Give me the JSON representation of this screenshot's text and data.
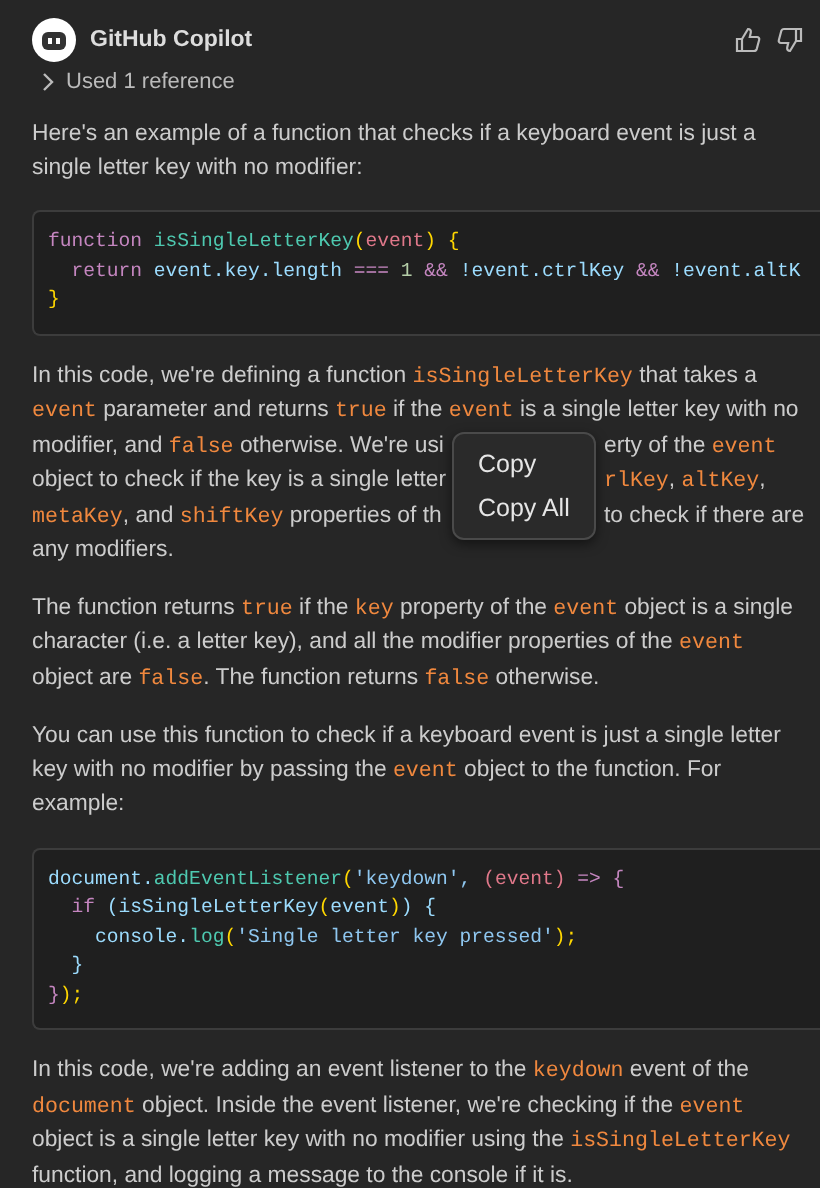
{
  "header": {
    "author": "GitHub Copilot"
  },
  "reference": {
    "label": "Used 1 reference",
    "expanded": false
  },
  "blocks": [
    {
      "kind": "paragraph",
      "segments": [
        {
          "text": "Here's an example of a function that checks if a keyboard event is just a single letter key with no modifier:",
          "kind": "text"
        }
      ]
    },
    {
      "kind": "code",
      "lines": [
        [
          {
            "t": "function ",
            "kind": "keyword"
          },
          {
            "t": "isSingleLetterKey",
            "kind": "function"
          },
          {
            "t": "(",
            "kind": "bracket"
          },
          {
            "t": "event",
            "kind": "param"
          },
          {
            "t": ") {",
            "kind": "bracket"
          }
        ],
        [
          {
            "t": "  return ",
            "kind": "keyword"
          },
          {
            "t": "event.key.length ",
            "kind": "variable"
          },
          {
            "t": "=== ",
            "kind": "keyword"
          },
          {
            "t": "1 ",
            "kind": "number"
          },
          {
            "t": "&& ",
            "kind": "keyword"
          },
          {
            "t": "!event.ctrlKey ",
            "kind": "variable"
          },
          {
            "t": "&& ",
            "kind": "keyword"
          },
          {
            "t": "!event.altK",
            "kind": "variable"
          }
        ],
        [
          {
            "t": "}",
            "kind": "bracket"
          }
        ]
      ]
    },
    {
      "kind": "lines",
      "lines": [
        {
          "left": [
            {
              "text": "In this code, we're defining a function ",
              "kind": "text"
            },
            {
              "text": "isSingleLetterKey",
              "kind": "code"
            },
            {
              "text": " that takes a",
              "kind": "text"
            }
          ]
        },
        {
          "left": [
            {
              "text": "event",
              "kind": "code"
            },
            {
              "text": " parameter and returns ",
              "kind": "text"
            },
            {
              "text": "true",
              "kind": "code"
            },
            {
              "text": " if the ",
              "kind": "text"
            },
            {
              "text": "event",
              "kind": "code"
            },
            {
              "text": " is a single letter key with no",
              "kind": "text"
            }
          ]
        },
        {
          "left": [
            {
              "text": "modifier, and ",
              "kind": "text"
            },
            {
              "text": "false",
              "kind": "code"
            },
            {
              "text": " otherwise. We're usi",
              "kind": "text"
            }
          ],
          "right": [
            {
              "text": "erty of the ",
              "kind": "text"
            },
            {
              "text": "event",
              "kind": "code"
            }
          ]
        },
        {
          "left": [
            {
              "text": "object to check if the key is a single letter",
              "kind": "text"
            }
          ],
          "right": [
            {
              "text": "rlKey",
              "kind": "code",
              "after": ", "
            },
            {
              "text": "altKey",
              "kind": "code",
              "after": ","
            }
          ]
        },
        {
          "left": [
            {
              "text": "metaKey",
              "kind": "code"
            },
            {
              "text": ", and ",
              "kind": "text"
            },
            {
              "text": "shiftKey",
              "kind": "code"
            },
            {
              "text": " properties of th",
              "kind": "text"
            }
          ],
          "right": [
            {
              "text": "to check if there are",
              "kind": "text"
            }
          ]
        },
        {
          "left": [
            {
              "text": "any modifiers.",
              "kind": "text"
            }
          ]
        }
      ],
      "context_menu": {
        "items": [
          "Copy",
          "Copy All"
        ]
      }
    },
    {
      "kind": "paragraph",
      "segments": [
        {
          "text": "The function returns ",
          "kind": "text"
        },
        {
          "text": "true",
          "kind": "code"
        },
        {
          "text": " if the ",
          "kind": "text"
        },
        {
          "text": "key",
          "kind": "code"
        },
        {
          "text": " property of the ",
          "kind": "text"
        },
        {
          "text": "event",
          "kind": "code"
        },
        {
          "text": " object is a single character (i.e. a letter key), and all the modifier properties of the ",
          "kind": "text"
        },
        {
          "text": "event",
          "kind": "code"
        },
        {
          "text": " object are ",
          "kind": "text"
        },
        {
          "text": "false",
          "kind": "code"
        },
        {
          "text": ". The function returns ",
          "kind": "text"
        },
        {
          "text": "false",
          "kind": "code"
        },
        {
          "text": " otherwise.",
          "kind": "text"
        }
      ]
    },
    {
      "kind": "paragraph",
      "segments": [
        {
          "text": "You can use this function to check if a keyboard event is just a single letter key with no modifier by passing the ",
          "kind": "text"
        },
        {
          "text": "event",
          "kind": "code"
        },
        {
          "text": " object to the function. For example:",
          "kind": "text"
        }
      ]
    },
    {
      "kind": "code",
      "lines": [
        [
          {
            "t": "document.",
            "kind": "variable"
          },
          {
            "t": "addEventListener",
            "kind": "function"
          },
          {
            "t": "(",
            "kind": "bracket"
          },
          {
            "t": "'keydown', ",
            "kind": "string"
          },
          {
            "t": "(event) ",
            "kind": "param"
          },
          {
            "t": "=> {",
            "kind": "keyword"
          }
        ],
        [
          {
            "t": "  if ",
            "kind": "keyword"
          },
          {
            "t": "(isSingleLetterKey",
            "kind": "variable"
          },
          {
            "t": "(",
            "kind": "bracket"
          },
          {
            "t": "event",
            "kind": "variable"
          },
          {
            "t": ")",
            "kind": "bracket"
          },
          {
            "t": ") {",
            "kind": "variable"
          }
        ],
        [
          {
            "t": "    console.",
            "kind": "variable"
          },
          {
            "t": "log",
            "kind": "function"
          },
          {
            "t": "(",
            "kind": "bracket"
          },
          {
            "t": "'Single letter key pressed'",
            "kind": "string"
          },
          {
            "t": ");",
            "kind": "bracket"
          }
        ],
        [
          {
            "t": "  }",
            "kind": "variable"
          }
        ],
        [
          {
            "t": "}",
            "kind": "keyword"
          },
          {
            "t": ");",
            "kind": "bracket"
          }
        ]
      ]
    },
    {
      "kind": "paragraph",
      "segments": [
        {
          "text": "In this code, we're adding an event listener to the ",
          "kind": "text"
        },
        {
          "text": "keydown",
          "kind": "code"
        },
        {
          "text": " event of the ",
          "kind": "text"
        },
        {
          "text": "document",
          "kind": "code"
        },
        {
          "text": " object. Inside the event listener, we're checking if the ",
          "kind": "text"
        },
        {
          "text": "event",
          "kind": "code"
        },
        {
          "text": " object is a single letter key with no modifier using the ",
          "kind": "text"
        },
        {
          "text": "isSingleLetterKey",
          "kind": "code"
        },
        {
          "text": " function, and logging a message to the console if it is.",
          "kind": "text"
        }
      ]
    }
  ]
}
